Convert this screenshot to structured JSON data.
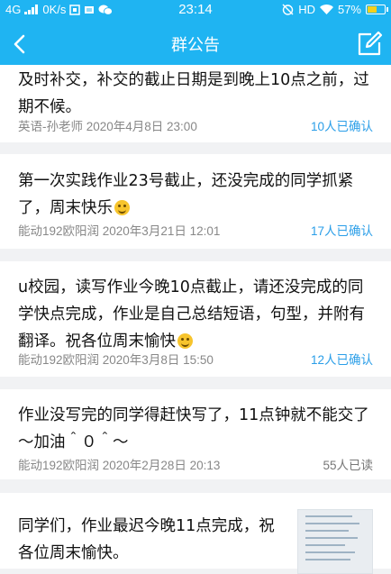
{
  "status_bar": {
    "network": "4G",
    "speed": "0K/s",
    "time": "23:14",
    "hd": "HD",
    "battery": "57%",
    "battery_level": 0.57
  },
  "header": {
    "title": "群公告"
  },
  "notices": [
    {
      "text": "及时补交，补交的截止日期是到晚上10点之前，过期不候。",
      "author_time": "英语-孙老师 2020年4月8日 23:00",
      "status": "10人已确认"
    },
    {
      "text": "第一次实践作业23号截止，还没完成的同学抓紧了，周末快乐",
      "author_time": "能动192欧阳润 2020年3月21日 12:01",
      "status": "17人已确认"
    },
    {
      "text": "u校园，读写作业今晚10点截止，请还没完成的同学快点完成，作业是自己总结短语，句型，并附有翻译。祝各位周末愉快",
      "author_time": "能动192欧阳润 2020年3月8日 15:50",
      "status": "12人已确认"
    },
    {
      "text": "作业没写完的同学得赶快写了，11点钟就不能交了～加油＾０＾～",
      "author_time": "能动192欧阳润 2020年2月28日 20:13",
      "status": "55人已读"
    },
    {
      "text": "同学们，作业最迟今晚11点完成，祝各位周末愉快。"
    }
  ]
}
